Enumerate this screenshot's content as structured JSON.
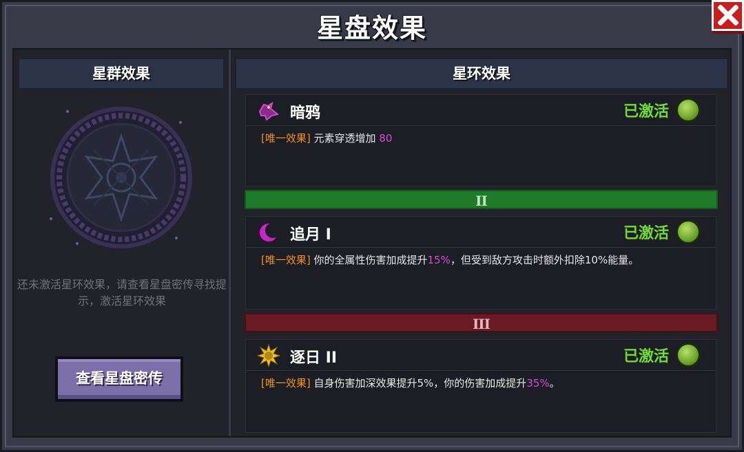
{
  "title": "星盘效果",
  "left_panel": {
    "header": "星群效果",
    "hint": "还未激活星环效果，请查看星盘密传寻找提示，激活星环效果",
    "button_label": "查看星盘密传"
  },
  "right_panel": {
    "header": "星环效果",
    "tiers": [
      "II",
      "III"
    ],
    "cards": [
      {
        "name": "暗鸦",
        "status": "已激活",
        "tag": "[唯一效果]",
        "text_before": "元素穿透增加 ",
        "highlight": "80",
        "text_after": "",
        "icon": "crow-icon"
      },
      {
        "name": "追月 I",
        "status": "已激活",
        "tag": "[唯一效果]",
        "text_before": "你的全属性伤害加成提升",
        "highlight": "15%",
        "text_after": "，但受到敌方攻击时额外扣除10%能量。",
        "icon": "crescent-moon-icon"
      },
      {
        "name": "逐日 II",
        "status": "已激活",
        "tag": "[唯一效果]",
        "text_before": "自身伤害加深效果提升5%，你的伤害加成提升",
        "highlight": "35%",
        "text_after": "。",
        "icon": "sun-icon"
      }
    ]
  },
  "colors": {
    "active": "#72d93c",
    "tag": "#f0931e",
    "highlight": "#d84bd8",
    "tier2": "#1f7a2a",
    "tier3": "#6a1a22"
  }
}
